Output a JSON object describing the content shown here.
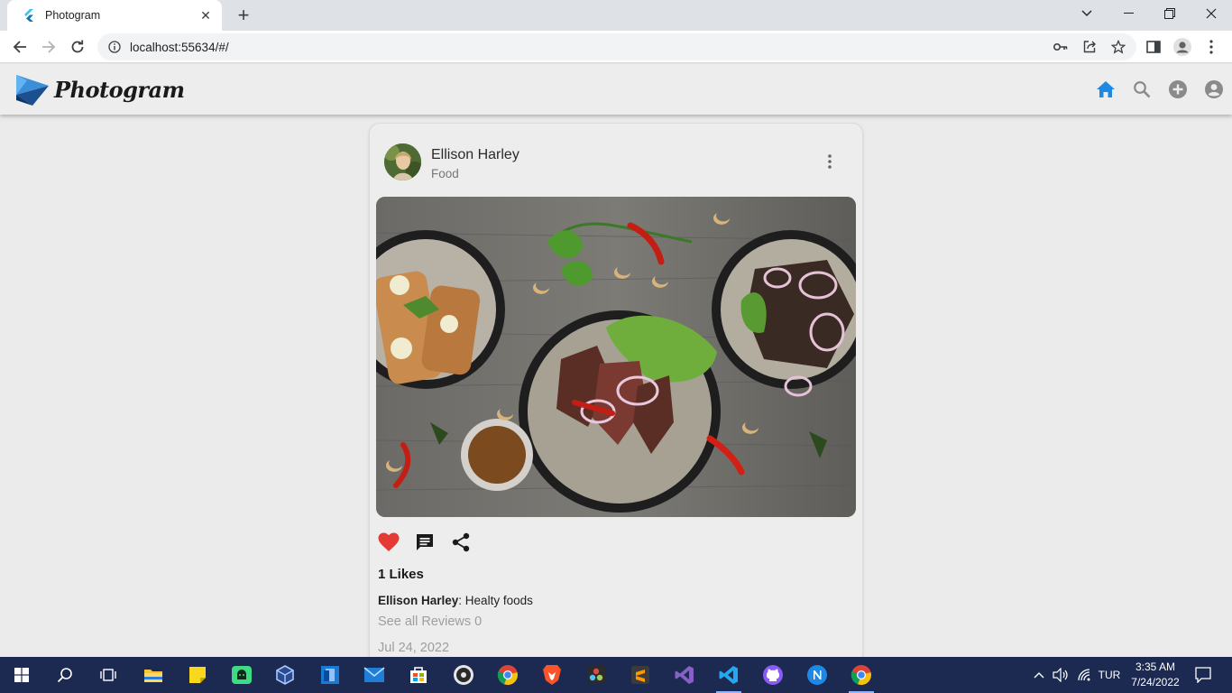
{
  "browser": {
    "tab_title": "Photogram",
    "url": "localhost:55634/#/"
  },
  "app": {
    "logo_text": "Photogram",
    "nav": [
      "home-icon",
      "search-icon",
      "add-icon",
      "account-icon"
    ],
    "accent": "#1e88e5"
  },
  "post": {
    "author": "Ellison Harley",
    "category": "Food",
    "likes_text": "1 Likes",
    "caption_author": "Ellison Harley",
    "caption_text": ": Healty foods",
    "reviews_text": "See all Reviews 0",
    "date": "Jul 24, 2022",
    "liked": true,
    "like_color": "#e53935"
  },
  "taskbar": {
    "lang": "TUR",
    "time": "3:35 AM",
    "date": "7/24/2022"
  }
}
